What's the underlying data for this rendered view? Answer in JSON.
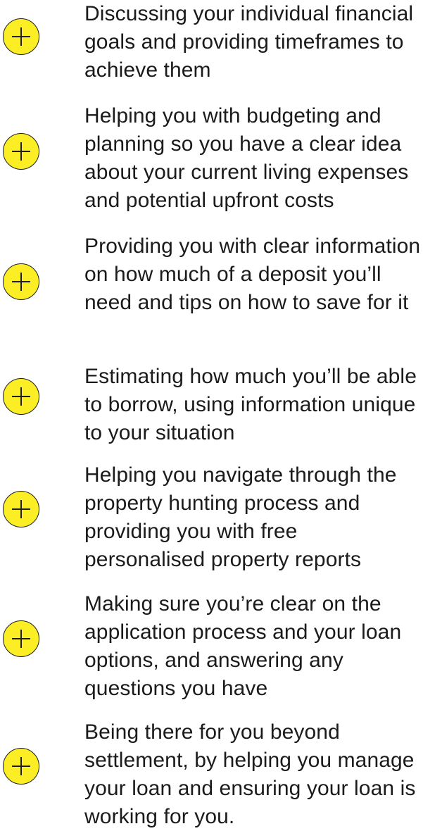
{
  "accent_color": "#fbee24",
  "items": [
    {
      "icon": "plus-icon",
      "text": "Discussing your individual financial goals and providing timeframes to achieve them"
    },
    {
      "icon": "plus-icon",
      "text": "Helping you with budgeting and planning so you have a clear idea about your current living expenses and potential upfront costs"
    },
    {
      "icon": "plus-icon",
      "text": "Providing you with clear information on how much of a deposit you’ll need and tips on how to save for it"
    },
    {
      "icon": "plus-icon",
      "text": "Estimating how much you’ll be able to borrow, using information unique to your situation"
    },
    {
      "icon": "plus-icon",
      "text": "Helping you navigate through the property hunting process and providing you with free personalised property reports"
    },
    {
      "icon": "plus-icon",
      "text": "Making sure you’re clear on the application process and your loan options, and answering any questions you have"
    },
    {
      "icon": "plus-icon",
      "text": "Being there for you beyond settlement, by helping you manage your loan and ensuring your loan is working for you."
    }
  ]
}
